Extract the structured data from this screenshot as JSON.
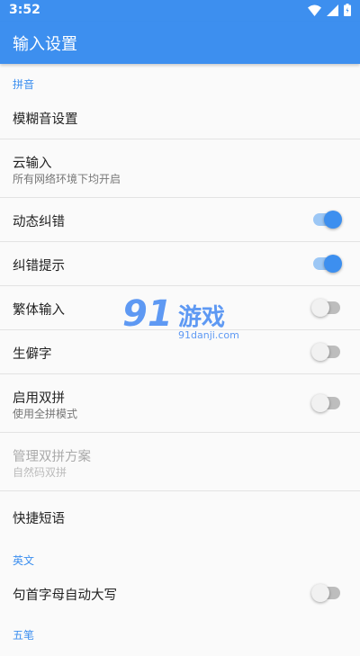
{
  "status": {
    "time": "3:52"
  },
  "appbar": {
    "title": "输入设置"
  },
  "sections": {
    "pinyin": "拼音",
    "english": "英文",
    "wubi": "五笔"
  },
  "rows": {
    "fuzzy": {
      "label": "模糊音设置"
    },
    "cloud": {
      "label": "云输入",
      "sub": "所有网络环境下均开启"
    },
    "dynamic": {
      "label": "动态纠错",
      "on": true
    },
    "hint": {
      "label": "纠错提示",
      "on": true
    },
    "traditional": {
      "label": "繁体输入",
      "on": false
    },
    "rare": {
      "label": "生僻字",
      "on": false
    },
    "shuangpin": {
      "label": "启用双拼",
      "sub": "使用全拼模式",
      "on": false
    },
    "scheme": {
      "label": "管理双拼方案",
      "sub": "自然码双拼",
      "disabled": true
    },
    "phrases": {
      "label": "快捷短语"
    },
    "capitalize": {
      "label": "句首字母自动大写",
      "on": false
    }
  },
  "watermark": {
    "logo": "91",
    "name": "游戏",
    "url": "91danji.com"
  },
  "colors": {
    "accent": "#3d8fef"
  }
}
